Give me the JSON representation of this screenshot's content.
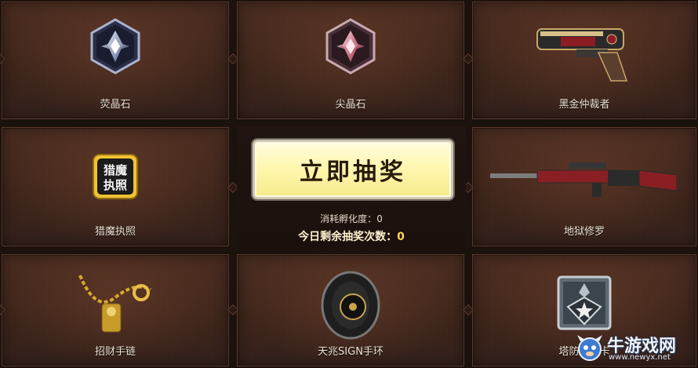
{
  "prizes": {
    "items": [
      {
        "label": "荧晶石",
        "icon": "silver-crystal-badge-icon"
      },
      {
        "label": "尖晶石",
        "icon": "pink-crystal-badge-icon"
      },
      {
        "label": "黑金仲裁者",
        "icon": "pistol-weapon-icon"
      },
      {
        "label": "猎魔执照",
        "icon": "license-badge-icon",
        "badge_text_line1": "猎魔",
        "badge_text_line2": "执照"
      },
      {
        "label": "地狱修罗",
        "icon": "rifle-weapon-icon"
      },
      {
        "label": "招财手链",
        "icon": "gold-bracelet-icon"
      },
      {
        "label": "天兆SIGN手环",
        "icon": "wristband-icon"
      },
      {
        "label": "塔防专家卡",
        "icon": "tower-defense-card-icon"
      }
    ]
  },
  "lottery": {
    "button_label": "立即抽奖",
    "cost_label": "消耗孵化度：",
    "cost_value": "0",
    "remaining_label": "今日剩余抽奖次数：",
    "remaining_value": "0"
  },
  "watermark": {
    "name": "牛游戏网",
    "url": "www.newyx.net"
  },
  "colors": {
    "button_bg": "#fff7b0",
    "panel_bg": "#3d241a",
    "highlight_number": "#ffd75a"
  }
}
